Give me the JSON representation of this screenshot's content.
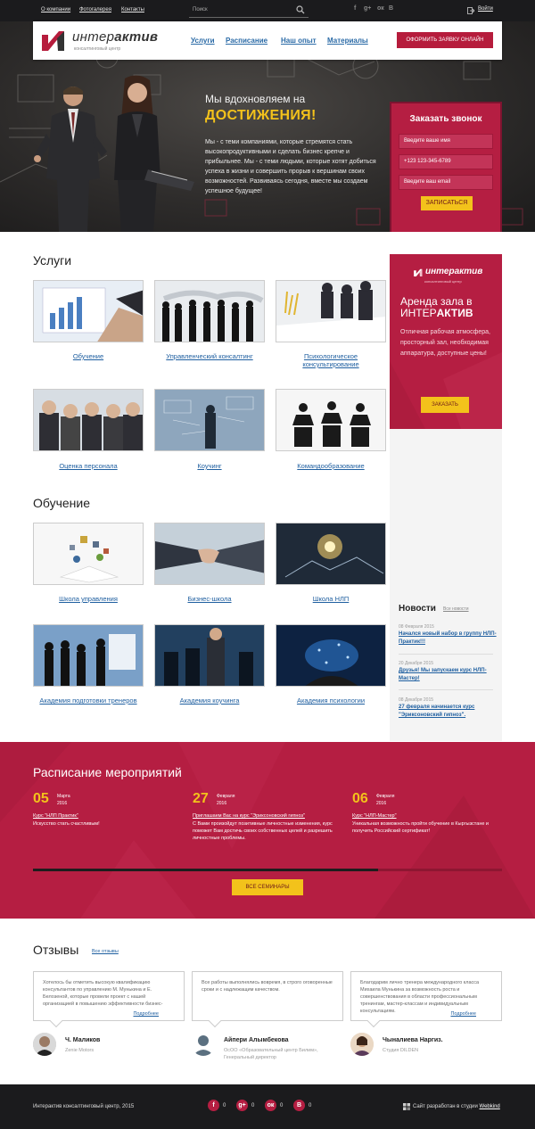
{
  "topbar": {
    "links": [
      "О компании",
      "Фотогалерея",
      "Контакты"
    ],
    "search_placeholder": "Поиск",
    "social": [
      "f",
      "g+",
      "ок",
      "B"
    ],
    "login": "Войти"
  },
  "header": {
    "logo_text_regular": "интер",
    "logo_text_bold": "актив",
    "logo_sub": "консалтинговый центр",
    "nav": [
      "Услуги",
      "Расписание",
      "Наш опыт",
      "Материалы"
    ],
    "order_button": "ОФОРМИТЬ ЗАЯВКУ ОНЛАЙН"
  },
  "hero": {
    "tagline": "Мы вдохновляем на",
    "tagline_accent": "ДОСТИЖЕНИЯ!",
    "text": "Мы - с теми компаниями, которые стремятся стать высокопродуктивными и сделать бизнес крепче и прибыльнее. Мы - с теми людьми, которые хотят добиться успеха в жизни и совершить прорыв к вершинам своих возможностей. Развиваясь сегодня, вместе мы создаем успешное будущее!"
  },
  "callback": {
    "title": "Заказать звонок",
    "name_placeholder": "Введите ваше имя",
    "phone_value": "+123 123-345-6789",
    "email_placeholder": "Введите ваш email",
    "submit": "ЗАПИСАТЬСЯ"
  },
  "services": {
    "title": "Услуги",
    "items": [
      "Обучение",
      "Управленческий консалтинг",
      "Психологическое консультирование",
      "Оценка персонала",
      "Коучинг",
      "Командообразование"
    ]
  },
  "training": {
    "title": "Обучение",
    "items": [
      "Школа управления",
      "Бизнес-школа",
      "Школа НЛП",
      "Академия подготовки тренеров",
      "Академия коучинга",
      "Академия психологии"
    ]
  },
  "sidebar_ad": {
    "logo_regular": "интер",
    "logo_bold": "актив",
    "logo_sub": "консалтинговый центр",
    "title_line1": "Аренда зала в",
    "title_line2_regular": "ИНТЕР",
    "title_line2_bold": "АКТИВ",
    "text": "Отличная рабочая атмосфера, просторный зал, необходимая аппаратура, доступные цены!",
    "button": "ЗАКАЗАТЬ"
  },
  "news": {
    "title": "Новости",
    "all_link": "Все новости",
    "items": [
      {
        "date": "08 Февраля 2015",
        "text": "Начался новый набор в группу НЛП-Практик!!!"
      },
      {
        "date": "20 Декабря 2015",
        "text": "Друзья! Мы запускаем курс НЛП-Мастер!"
      },
      {
        "date": "08 Декабря 2015",
        "text": "27 февраля начинается курс \"Эриксоновский гипноз\"."
      }
    ]
  },
  "events": {
    "title": "Расписание мероприятий",
    "button": "ВСЕ СЕМИНАРЫ",
    "items": [
      {
        "day": "05",
        "month": "Марта",
        "year": "2016",
        "link": "Курс \"НЛП Практик\"",
        "desc": "Искусство стать счастливым!"
      },
      {
        "day": "27",
        "month": "Февраля",
        "year": "2016",
        "link": "Приглашаем Вас на курс \"Эриксоновский гипноз\"",
        "desc": "С Вами произойдут позитивные личностные изменения, курс поможет Вам достичь своих собственных целей и разрешить личностные проблемы."
      },
      {
        "day": "06",
        "month": "Февраля",
        "year": "2016",
        "link": "Курс \"НЛП-Мастер\"",
        "desc": "Уникальная возможность пройти обучение в Кыргызстане и получить Российский сертификат!"
      }
    ]
  },
  "reviews": {
    "title": "Отзывы",
    "all_link": "Все отзывы",
    "more": "Подробнее",
    "items": [
      {
        "text": "Хотелось бы отметить высокую квалификацию консультантов по управлению М. Мунькина и Е. Белозеной, которые провели проект с нашей организацией в повышению эффективности бизнес-",
        "name": "Ч. Маликов",
        "org": "Zenie Motors"
      },
      {
        "text": "Все работы выполнялись вовремя, в строго оговоренные сроки и с надлежащим качеством.",
        "name": "Айпери Алымбекова",
        "org": "ОсОО «Образовательный центр Билим», Генеральный директор"
      },
      {
        "text": "Благодарим лично тренера международного класса Михаила Мунькина за возможность роста и совершенствования в области профессиональным тренингам, мастер-классам и индивидуальным консультациям.",
        "name": "Чыналиева Наргиз.",
        "org": "Студия DILDEN"
      }
    ]
  },
  "footer": {
    "copyright": "Интерактив консалтинговый центр, 2015",
    "social": [
      {
        "icon": "f",
        "count": "0"
      },
      {
        "icon": "g+",
        "count": "0"
      },
      {
        "icon": "ок",
        "count": "0"
      },
      {
        "icon": "B",
        "count": "0"
      }
    ],
    "dev_prefix": "Сайт разработан в студии",
    "dev_link": "Webkind"
  }
}
